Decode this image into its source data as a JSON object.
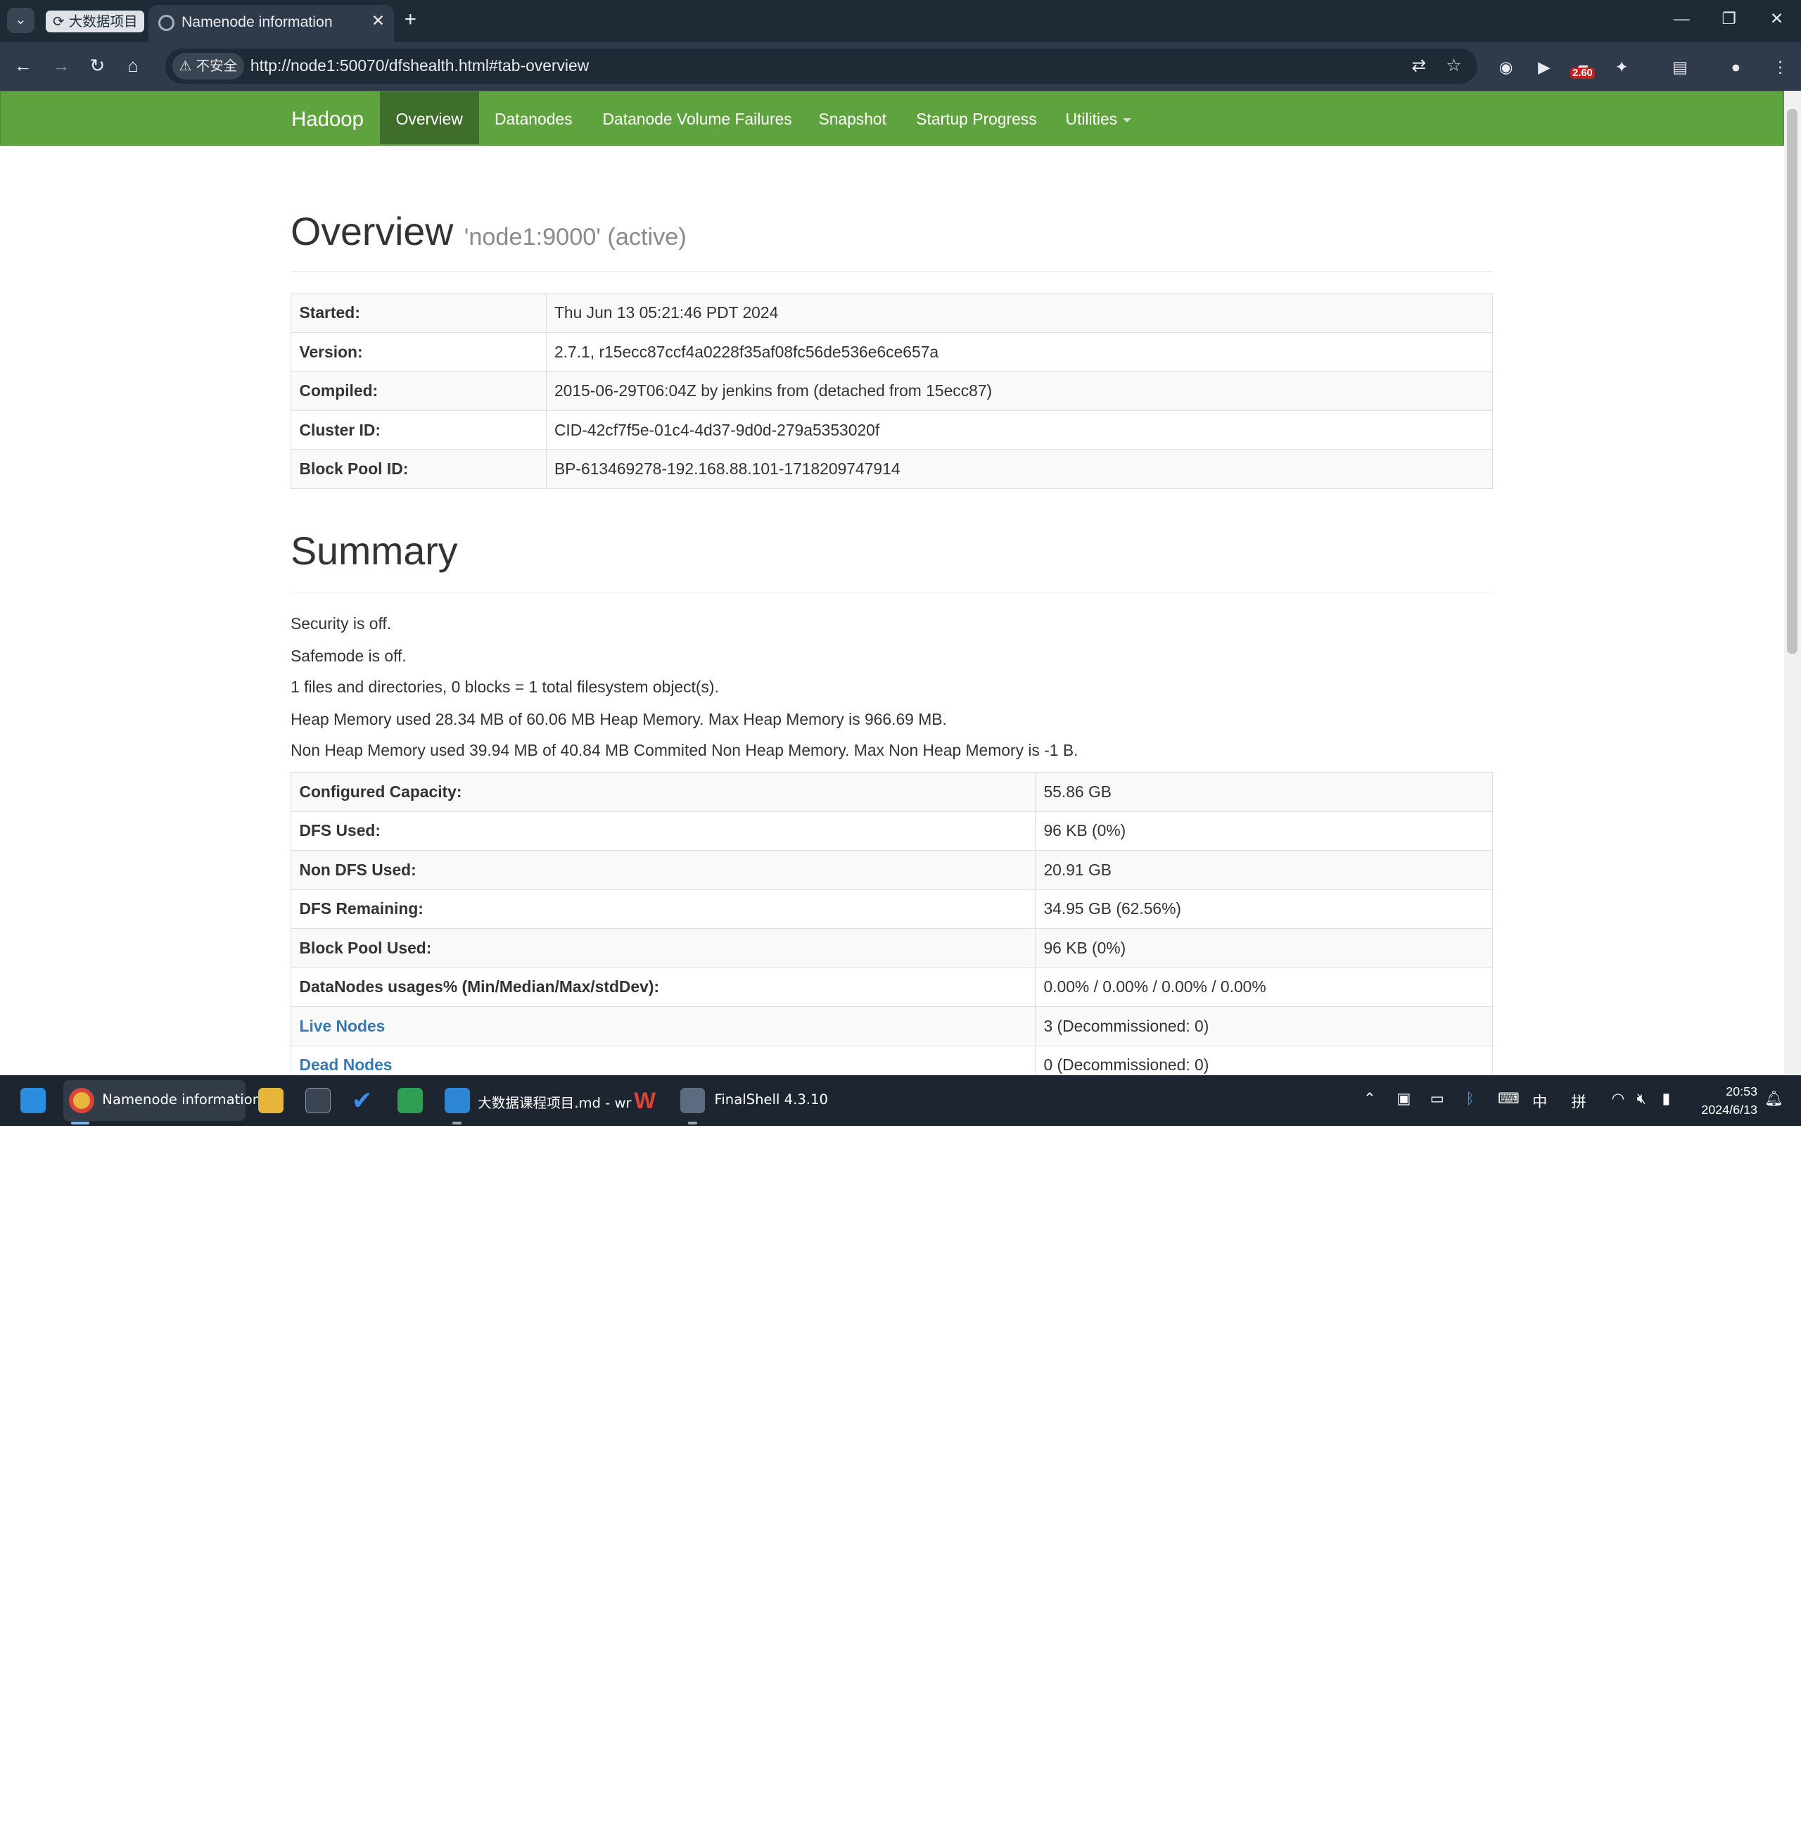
{
  "browser": {
    "tab_group_label": "大数据项目",
    "active_tab_title": "Namenode information",
    "insecure_label": "不安全",
    "url": "http://node1:50070/dfshealth.html#tab-overview",
    "extension_badge": "2.60"
  },
  "nav": {
    "brand": "Hadoop",
    "items": [
      "Overview",
      "Datanodes",
      "Datanode Volume Failures",
      "Snapshot",
      "Startup Progress",
      "Utilities"
    ]
  },
  "overview": {
    "title": "Overview",
    "subtitle": "'node1:9000' (active)",
    "rows": [
      {
        "key": "Started:",
        "value": "Thu Jun 13 05:21:46 PDT 2024"
      },
      {
        "key": "Version:",
        "value": "2.7.1, r15ecc87ccf4a0228f35af08fc56de536e6ce657a"
      },
      {
        "key": "Compiled:",
        "value": "2015-06-29T06:04Z by jenkins from (detached from 15ecc87)"
      },
      {
        "key": "Cluster ID:",
        "value": "CID-42cf7f5e-01c4-4d37-9d0d-279a5353020f"
      },
      {
        "key": "Block Pool ID:",
        "value": "BP-613469278-192.168.88.101-1718209747914"
      }
    ]
  },
  "summary": {
    "title": "Summary",
    "lines": [
      "Security is off.",
      "Safemode is off.",
      "1 files and directories, 0 blocks = 1 total filesystem object(s).",
      "Heap Memory used 28.34 MB of 60.06 MB Heap Memory. Max Heap Memory is 966.69 MB.",
      "Non Heap Memory used 39.94 MB of 40.84 MB Commited Non Heap Memory. Max Non Heap Memory is -1 B."
    ],
    "rows": [
      {
        "key": "Configured Capacity:",
        "value": "55.86 GB"
      },
      {
        "key": "DFS Used:",
        "value": "96 KB (0%)"
      },
      {
        "key": "Non DFS Used:",
        "value": "20.91 GB"
      },
      {
        "key": "DFS Remaining:",
        "value": "34.95 GB (62.56%)"
      },
      {
        "key": "Block Pool Used:",
        "value": "96 KB (0%)"
      },
      {
        "key": "DataNodes usages% (Min/Median/Max/stdDev):",
        "value": "0.00% / 0.00% / 0.00% / 0.00%"
      },
      {
        "key": "Live Nodes",
        "value": "3 (Decommissioned: 0)"
      },
      {
        "key": "Dead Nodes",
        "value": "0 (Decommissioned: 0)"
      }
    ]
  },
  "taskbar": {
    "chrome_label": "Namenode information",
    "vscode_label": "大数据课程项目.md - wr",
    "finalshell_label": "FinalShell 4.3.10",
    "ime_1": "中",
    "ime_2": "拼",
    "time": "20:53",
    "date": "2024/6/13"
  },
  "colors": {
    "navbar": "#5fa33e",
    "navbar_active": "#3f6e2a",
    "link": "#337ab7"
  }
}
